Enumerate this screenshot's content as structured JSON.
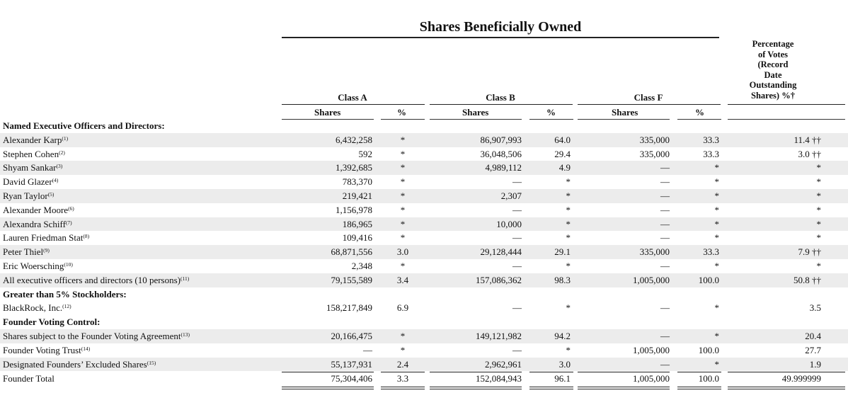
{
  "title": "Shares Beneficially Owned",
  "percentage_header": [
    "Percentage",
    "of Votes",
    "(Record",
    "Date",
    "Outstanding",
    "Shares) %†"
  ],
  "class_headers": [
    "Class A",
    "Class B",
    "Class F"
  ],
  "sub_headers": {
    "shares": "Shares",
    "percent": "%"
  },
  "rows": [
    {
      "type": "section",
      "label": "Named Executive Officers and Directors:"
    },
    {
      "type": "data",
      "label": "Alexander Karp",
      "note": "(1)",
      "a_shares": "6,432,258",
      "a_pct": "*",
      "b_shares": "86,907,993",
      "b_pct": "64.0",
      "f_shares": "335,000",
      "f_pct": "33.3",
      "votes": "11.4 ††"
    },
    {
      "type": "data",
      "label": "Stephen Cohen",
      "note": "(2)",
      "a_shares": "592",
      "a_pct": "*",
      "b_shares": "36,048,506",
      "b_pct": "29.4",
      "f_shares": "335,000",
      "f_pct": "33.3",
      "votes": "3.0 ††"
    },
    {
      "type": "data",
      "label": "Shyam Sankar",
      "note": "(3)",
      "a_shares": "1,392,685",
      "a_pct": "*",
      "b_shares": "4,989,112",
      "b_pct": "4.9",
      "f_shares": "—",
      "f_pct": "*",
      "votes": "*"
    },
    {
      "type": "data",
      "label": "David Glazer",
      "note": "(4)",
      "a_shares": "783,370",
      "a_pct": "*",
      "b_shares": "—",
      "b_pct": "*",
      "f_shares": "—",
      "f_pct": "*",
      "votes": "*"
    },
    {
      "type": "data",
      "label": "Ryan Taylor",
      "note": "(5)",
      "a_shares": "219,421",
      "a_pct": "*",
      "b_shares": "2,307",
      "b_pct": "*",
      "f_shares": "—",
      "f_pct": "*",
      "votes": "*"
    },
    {
      "type": "data",
      "label": "Alexander Moore",
      "note": "(6)",
      "a_shares": "1,156,978",
      "a_pct": "*",
      "b_shares": "—",
      "b_pct": "*",
      "f_shares": "—",
      "f_pct": "*",
      "votes": "*"
    },
    {
      "type": "data",
      "label": "Alexandra Schiff",
      "note": "(7)",
      "a_shares": "186,965",
      "a_pct": "*",
      "b_shares": "10,000",
      "b_pct": "*",
      "f_shares": "—",
      "f_pct": "*",
      "votes": "*"
    },
    {
      "type": "data",
      "label": "Lauren Friedman Stat",
      "note": "(8)",
      "a_shares": "109,416",
      "a_pct": "*",
      "b_shares": "—",
      "b_pct": "*",
      "f_shares": "—",
      "f_pct": "*",
      "votes": "*"
    },
    {
      "type": "data",
      "label": "Peter Thiel",
      "note": "(9)",
      "a_shares": "68,871,556",
      "a_pct": "3.0",
      "b_shares": "29,128,444",
      "b_pct": "29.1",
      "f_shares": "335,000",
      "f_pct": "33.3",
      "votes": "7.9 ††"
    },
    {
      "type": "data",
      "label": "Eric Woersching",
      "note": "(10)",
      "a_shares": "2,348",
      "a_pct": "*",
      "b_shares": "—",
      "b_pct": "*",
      "f_shares": "—",
      "f_pct": "*",
      "votes": "*"
    },
    {
      "type": "data",
      "label": "All executive officers and directors (10 persons)",
      "note": "(11)",
      "a_shares": "79,155,589",
      "a_pct": "3.4",
      "b_shares": "157,086,362",
      "b_pct": "98.3",
      "f_shares": "1,005,000",
      "f_pct": "100.0",
      "votes": "50.8 ††"
    },
    {
      "type": "section",
      "label": "Greater than 5% Stockholders:"
    },
    {
      "type": "data",
      "label": "BlackRock, Inc.",
      "note": "(12)",
      "a_shares": "158,217,849",
      "a_pct": "6.9",
      "b_shares": "—",
      "b_pct": "*",
      "f_shares": "—",
      "f_pct": "*",
      "votes": "3.5"
    },
    {
      "type": "section",
      "label": "Founder Voting Control:"
    },
    {
      "type": "data",
      "label": "Shares subject to the Founder Voting Agreement",
      "note": "(13)",
      "a_shares": "20,166,475",
      "a_pct": "*",
      "b_shares": "149,121,982",
      "b_pct": "94.2",
      "f_shares": "—",
      "f_pct": "*",
      "votes": "20.4"
    },
    {
      "type": "data",
      "label": "Founder Voting Trust",
      "note": "(14)",
      "a_shares": "—",
      "a_pct": "*",
      "b_shares": "—",
      "b_pct": "*",
      "f_shares": "1,005,000",
      "f_pct": "100.0",
      "votes": "27.7"
    },
    {
      "type": "data",
      "label": "Designated Founders’ Excluded Shares",
      "note": "(15)",
      "a_shares": "55,137,931",
      "a_pct": "2.4",
      "b_shares": "2,962,961",
      "b_pct": "3.0",
      "f_shares": "—",
      "f_pct": "*",
      "votes": "1.9"
    },
    {
      "type": "total",
      "label": "Founder Total",
      "note": "",
      "a_shares": "75,304,406",
      "a_pct": "3.3",
      "b_shares": "152,084,943",
      "b_pct": "96.1",
      "f_shares": "1,005,000",
      "f_pct": "100.0",
      "votes": "49.999999"
    }
  ]
}
